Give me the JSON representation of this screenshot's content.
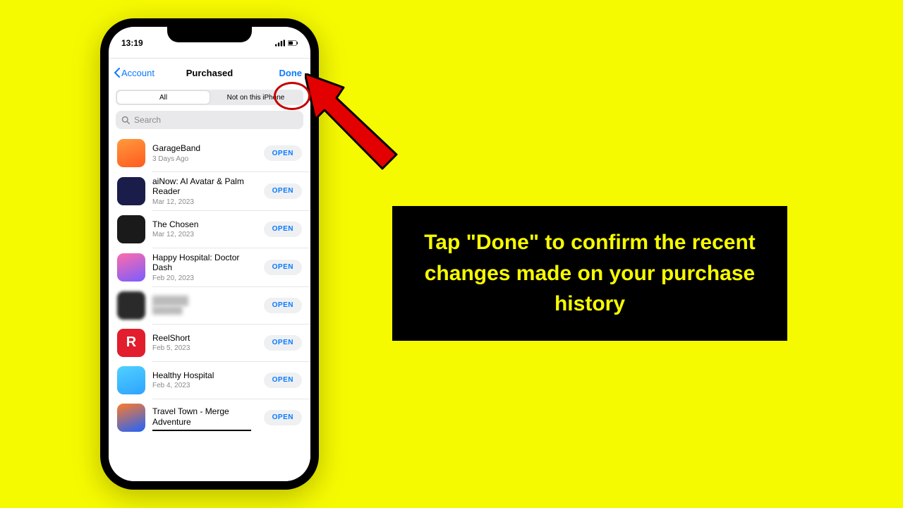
{
  "status": {
    "time": "13:19",
    "battery": "51"
  },
  "nav": {
    "back": "Account",
    "title": "Purchased",
    "done": "Done"
  },
  "segmented": {
    "all": "All",
    "not": "Not on this iPhone"
  },
  "search": {
    "placeholder": "Search"
  },
  "open_label": "OPEN",
  "apps": [
    {
      "name": "GarageBand",
      "date": "3 Days Ago"
    },
    {
      "name": "aiNow: AI Avatar & Palm Reader",
      "date": "Mar 12, 2023"
    },
    {
      "name": "The Chosen",
      "date": "Mar 12, 2023"
    },
    {
      "name": "Happy Hospital: Doctor Dash",
      "date": "Feb 20, 2023"
    },
    {
      "name": "██████",
      "date": "██████"
    },
    {
      "name": "ReelShort",
      "date": "Feb 5, 2023"
    },
    {
      "name": "Healthy Hospital",
      "date": "Feb 4, 2023"
    },
    {
      "name": "Travel Town - Merge Adventure",
      "date": ""
    }
  ],
  "callout": "Tap \"Done\" to confirm the recent changes made on your purchase history"
}
